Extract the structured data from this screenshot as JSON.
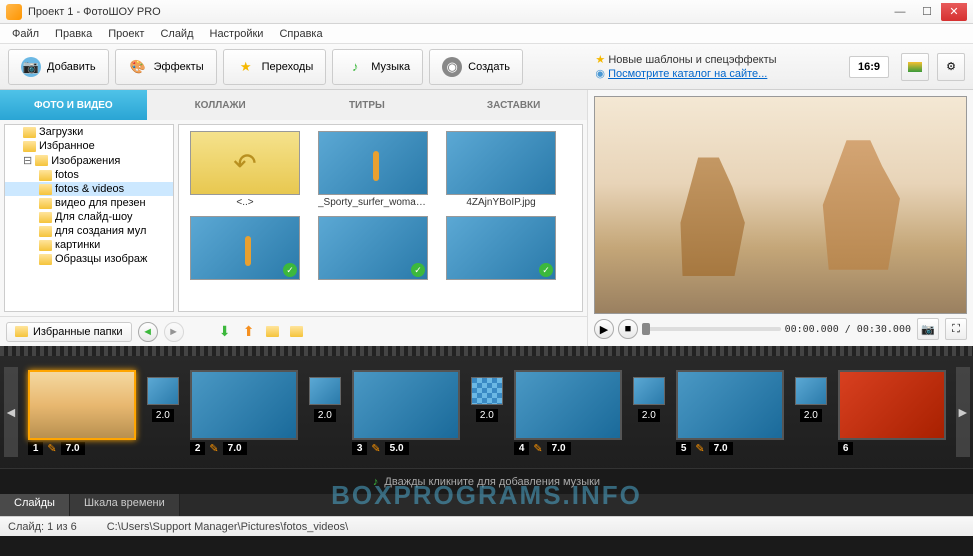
{
  "title": "Проект 1 - ФотоШОУ PRO",
  "menu": [
    "Файл",
    "Правка",
    "Проект",
    "Слайд",
    "Настройки",
    "Справка"
  ],
  "toolbar": {
    "add": "Добавить",
    "fx": "Эффекты",
    "trans": "Переходы",
    "music": "Музыка",
    "create": "Создать"
  },
  "hints": {
    "t1": "Новые шаблоны и спецэффекты",
    "t2": "Посмотрите каталог на сайте..."
  },
  "aspect": "16:9",
  "tabs": [
    "ФОТО И ВИДЕО",
    "КОЛЛАЖИ",
    "ТИТРЫ",
    "ЗАСТАВКИ"
  ],
  "tree": [
    {
      "l": "Загрузки",
      "d": 1
    },
    {
      "l": "Избранное",
      "d": 1
    },
    {
      "l": "Изображения",
      "d": 1,
      "exp": true
    },
    {
      "l": "fotos",
      "d": 2
    },
    {
      "l": "fotos & videos",
      "d": 2,
      "sel": true
    },
    {
      "l": "видео для презен",
      "d": 2
    },
    {
      "l": "Для слайд-шоу",
      "d": 2
    },
    {
      "l": "для создания мул",
      "d": 2
    },
    {
      "l": "картинки",
      "d": 2
    },
    {
      "l": "Образцы изображ",
      "d": 2
    }
  ],
  "gallery": [
    {
      "n": "<..>",
      "up": true
    },
    {
      "n": "_Sporty_surfer_woman_0...",
      "surf": true
    },
    {
      "n": "4ZAjnYBoIP.jpg"
    },
    {
      "n": "",
      "surf": true,
      "chk": true
    },
    {
      "n": "",
      "chk": true
    },
    {
      "n": "",
      "chk": true
    }
  ],
  "fav": "Избранные папки",
  "playback": {
    "time": "00:00.000 / 00:30.000"
  },
  "timeline": {
    "slides": [
      {
        "n": "1",
        "d": "7.0",
        "cls": "sunset",
        "sel": true
      },
      {
        "n": "2",
        "d": "7.0"
      },
      {
        "n": "3",
        "d": "5.0"
      },
      {
        "n": "4",
        "d": "7.0"
      },
      {
        "n": "5",
        "d": "7.0"
      },
      {
        "n": "6",
        "cls": "red"
      }
    ],
    "trans": [
      {
        "d": "2.0"
      },
      {
        "d": "2.0"
      },
      {
        "d": "2.0",
        "chk": true
      },
      {
        "d": "2.0"
      },
      {
        "d": "2.0"
      }
    ],
    "music_hint": "Дважды кликните для добавления музыки",
    "tabs": [
      "Слайды",
      "Шкала времени"
    ]
  },
  "status": {
    "slide": "Слайд: 1 из 6",
    "path": "C:\\Users\\Support Manager\\Pictures\\fotos_videos\\"
  },
  "watermark": "BOXPROGRAMS.INFO"
}
